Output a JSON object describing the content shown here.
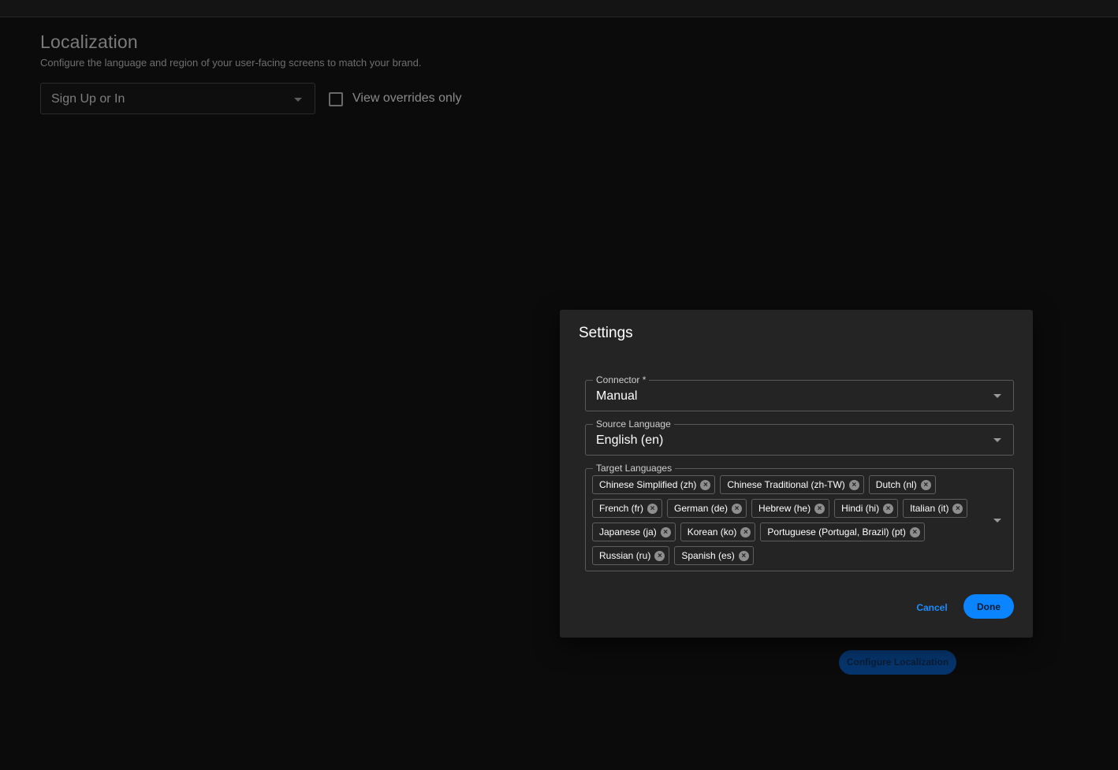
{
  "page": {
    "title": "Localization",
    "subtitle": "Configure the language and region of your user-facing screens to match your brand.",
    "screen_select_value": "Sign Up or In",
    "override_label": "View overrides only",
    "configure_button": "Configure Localization"
  },
  "dialog": {
    "title": "Settings",
    "connector": {
      "label": "Connector *",
      "value": "Manual"
    },
    "source_language": {
      "label": "Source Language",
      "value": "English (en)"
    },
    "target_languages": {
      "label": "Target Languages",
      "chips": [
        "Chinese Simplified (zh)",
        "Chinese Traditional (zh-TW)",
        "Dutch (nl)",
        "French (fr)",
        "German (de)",
        "Hebrew (he)",
        "Hindi (hi)",
        "Italian (it)",
        "Japanese (ja)",
        "Korean (ko)",
        "Portuguese (Portugal, Brazil) (pt)",
        "Russian (ru)",
        "Spanish (es)"
      ]
    },
    "cancel_label": "Cancel",
    "done_label": "Done"
  },
  "colors": {
    "accent": "#0a84ff",
    "background": "#0b0b0b",
    "dialog": "#242424"
  },
  "icons": {
    "chip_remove": "cancel-circle-icon",
    "dropdown": "chevron-down-icon"
  }
}
